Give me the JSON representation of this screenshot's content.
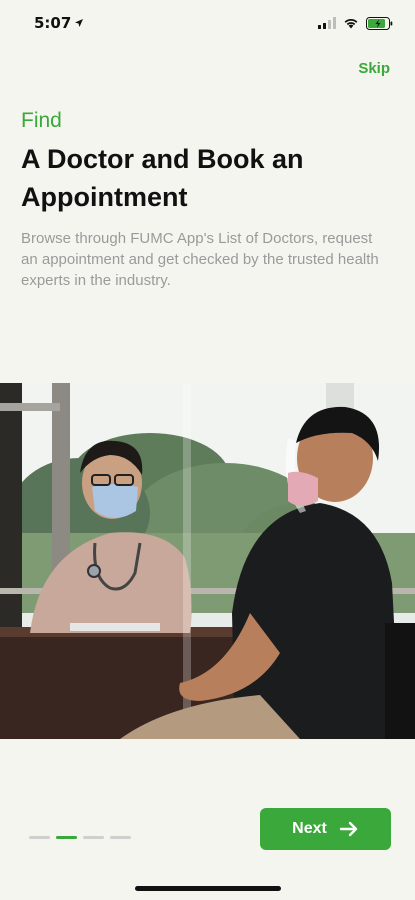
{
  "status_bar": {
    "time": "5:07",
    "battery_color": "#3aa83a"
  },
  "skip_label": "Skip",
  "onboarding": {
    "kicker": "Find",
    "headline": "A Doctor and Book an Appointment",
    "description": "Browse through FUMC App's List of Doctors, request an appointment and get checked by the trusted health experts in the industry."
  },
  "pagination": {
    "total": 4,
    "active_index": 1
  },
  "next_label": "Next",
  "colors": {
    "accent": "#3aa83a",
    "background": "#f5f5f0",
    "muted_text": "#9a9a9a"
  }
}
